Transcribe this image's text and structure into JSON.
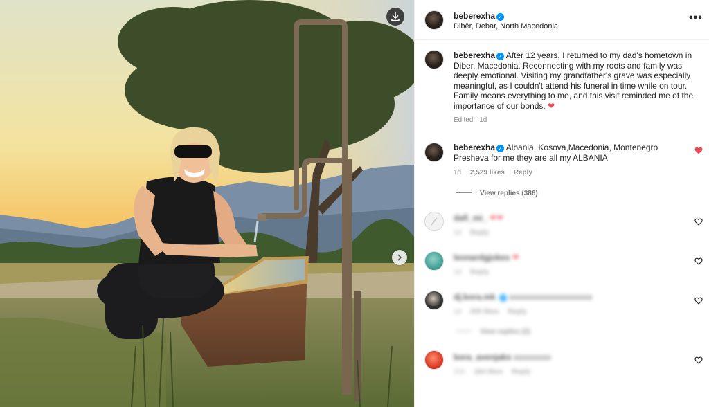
{
  "post": {
    "username": "beberexha",
    "location": "Dibër, Debar, North Macedonia",
    "caption": "After 12 years, I returned to my dad's hometown in Diber, Macedonia. Reconnecting with my roots and family was deeply emotional. Visiting my grandfather's grave was especially meaningful, as I couldn't attend his funeral in time while on tour. Family means everything to me, and this visit reminded me of the importance of our bonds.",
    "caption_emoji": "❤",
    "edited_label": "Edited",
    "time_ago": "1d"
  },
  "comments": [
    {
      "username": "beberexha",
      "line1": "Albania, Kosova,Macedonia, Montenegro",
      "line2": "Presheva for me they are all my ALBANIA",
      "time": "1d",
      "likes": "2,529 likes",
      "reply": "Reply",
      "view_replies": "View replies (386)",
      "liked": true
    },
    {
      "username": "dafi_mi_",
      "emoji": "❤❤",
      "time": "1d",
      "reply": "Reply",
      "blurred": true
    },
    {
      "username": "leonardgjokes",
      "emoji": "❤",
      "time": "1d",
      "reply": "Reply",
      "blurred": true
    },
    {
      "username": "dj.bora.mk",
      "text": "xxxxxxxxxxxxxxxxxxxx",
      "time": "1d",
      "likes": "200 likes",
      "reply": "Reply",
      "view_replies": "View replies (2)",
      "blurred": true
    },
    {
      "username": "bora_avenjaks",
      "text": "xxxxxxxxx",
      "time": "21h",
      "likes": "164 likes",
      "reply": "Reply",
      "blurred": true
    }
  ],
  "icons": {
    "download": "download-icon",
    "next": "chevron-right-icon",
    "more": "more-horizontal-icon",
    "like": "heart-icon"
  },
  "colors": {
    "verified": "#0095f6",
    "liked_heart": "#ed4956"
  }
}
